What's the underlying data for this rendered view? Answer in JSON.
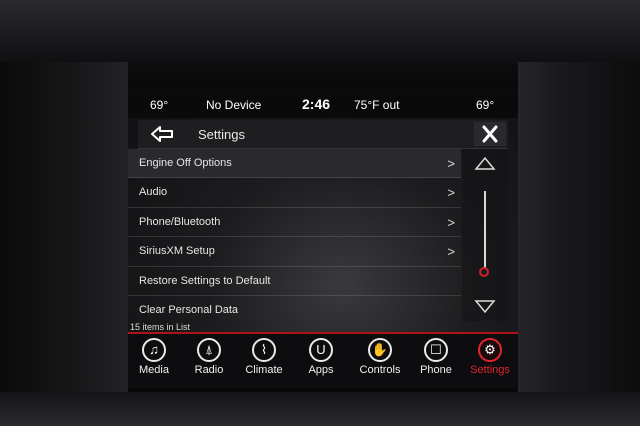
{
  "status": {
    "temp_left": "69°",
    "device": "No Device",
    "time": "2:46",
    "outside": "75°F out",
    "temp_right": "69°"
  },
  "header": {
    "title": "Settings",
    "back_icon": "back-arrow-icon",
    "close_icon": "close-icon"
  },
  "list": {
    "items": [
      {
        "label": "Engine Off Options",
        "chevron": ">"
      },
      {
        "label": "Audio",
        "chevron": ">"
      },
      {
        "label": "Phone/Bluetooth",
        "chevron": ">"
      },
      {
        "label": "SiriusXM Setup",
        "chevron": ">"
      },
      {
        "label": "Restore Settings to Default",
        "chevron": ""
      },
      {
        "label": "Clear Personal Data",
        "chevron": ""
      }
    ],
    "count_text": "15 items in List"
  },
  "nav": {
    "items": [
      {
        "label": "Media",
        "glyph": "♫"
      },
      {
        "label": "Radio",
        "glyph": "⍋"
      },
      {
        "label": "Climate",
        "glyph": "⌇"
      },
      {
        "label": "Apps",
        "glyph": "U"
      },
      {
        "label": "Controls",
        "glyph": "✋"
      },
      {
        "label": "Phone",
        "glyph": "☐"
      },
      {
        "label": "Settings",
        "glyph": "⚙"
      }
    ],
    "active": "Settings"
  },
  "colors": {
    "accent": "#e0252f",
    "screen_bg": "#1c1c1e"
  }
}
